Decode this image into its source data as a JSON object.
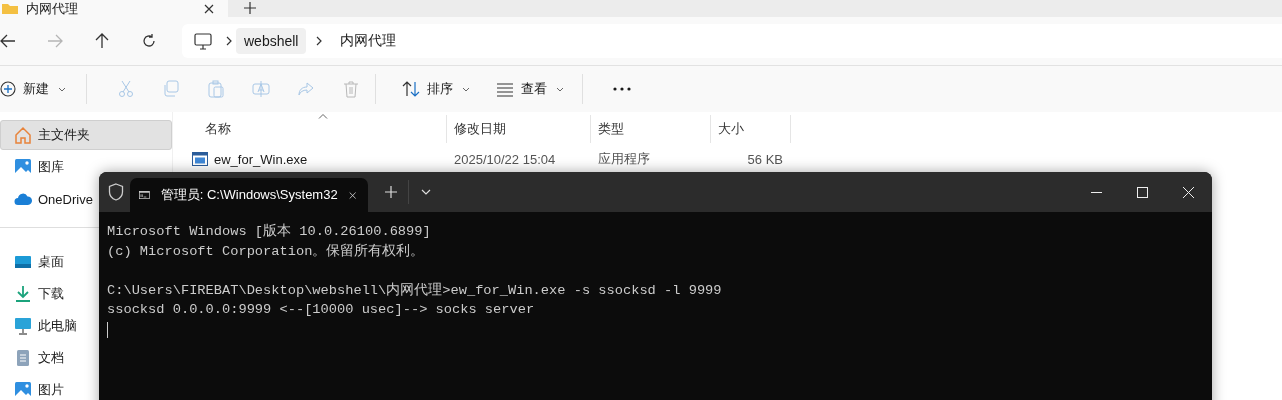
{
  "explorer_tab": {
    "title": "内网代理"
  },
  "nav_buttons": [
    {
      "kind": "back",
      "disabled": false
    },
    {
      "kind": "forward",
      "disabled": true
    },
    {
      "kind": "up",
      "disabled": false
    },
    {
      "kind": "refresh",
      "disabled": false
    }
  ],
  "address": {
    "segments": [
      "webshell",
      "内网代理"
    ]
  },
  "toolbar": [
    {
      "kind": "new",
      "label": "新建",
      "disabled": false
    },
    {
      "kind": "cut",
      "disabled": true
    },
    {
      "kind": "copy",
      "disabled": true
    },
    {
      "kind": "paste",
      "disabled": true
    },
    {
      "kind": "rename",
      "disabled": true
    },
    {
      "kind": "share",
      "disabled": true
    },
    {
      "kind": "delete",
      "disabled": true
    },
    {
      "kind": "sort",
      "label": "排序",
      "disabled": false
    },
    {
      "kind": "view",
      "label": "查看",
      "disabled": false
    },
    {
      "kind": "more",
      "disabled": false
    }
  ],
  "sidebar": {
    "groups": [
      [
        {
          "kind": "home",
          "label": "主文件夹",
          "selected": true
        },
        {
          "kind": "gallery",
          "label": "图库",
          "selected": false
        },
        {
          "kind": "cloud",
          "label": "OneDrive",
          "selected": false
        }
      ],
      [
        {
          "kind": "desktop",
          "label": "桌面",
          "selected": false
        },
        {
          "kind": "download",
          "label": "下载",
          "selected": false
        },
        {
          "kind": "pc",
          "label": "此电脑",
          "selected": false
        },
        {
          "kind": "document",
          "label": "文档",
          "selected": false
        },
        {
          "kind": "pictures",
          "label": "图片",
          "selected": false
        }
      ]
    ]
  },
  "file_list": {
    "columns": [
      "名称",
      "修改日期",
      "类型",
      "大小"
    ],
    "rows": [
      {
        "name": "ew_for_Win.exe",
        "date": "2025/10/22 15:04",
        "type": "应用程序",
        "size": "56 KB"
      }
    ]
  },
  "terminal": {
    "tab_title": "管理员: C:\\Windows\\System32",
    "blocks": [
      [
        "Microsoft Windows [版本 10.0.26100.6899]",
        "(c) Microsoft Corporation。保留所有权利。"
      ],
      [
        "C:\\Users\\FIREBAT\\Desktop\\webshell\\内网代理>ew_for_Win.exe -s ssocksd -l 9999",
        "ssocksd 0.0.0.0:9999 <--[10000 usec]--> socks server"
      ]
    ]
  }
}
